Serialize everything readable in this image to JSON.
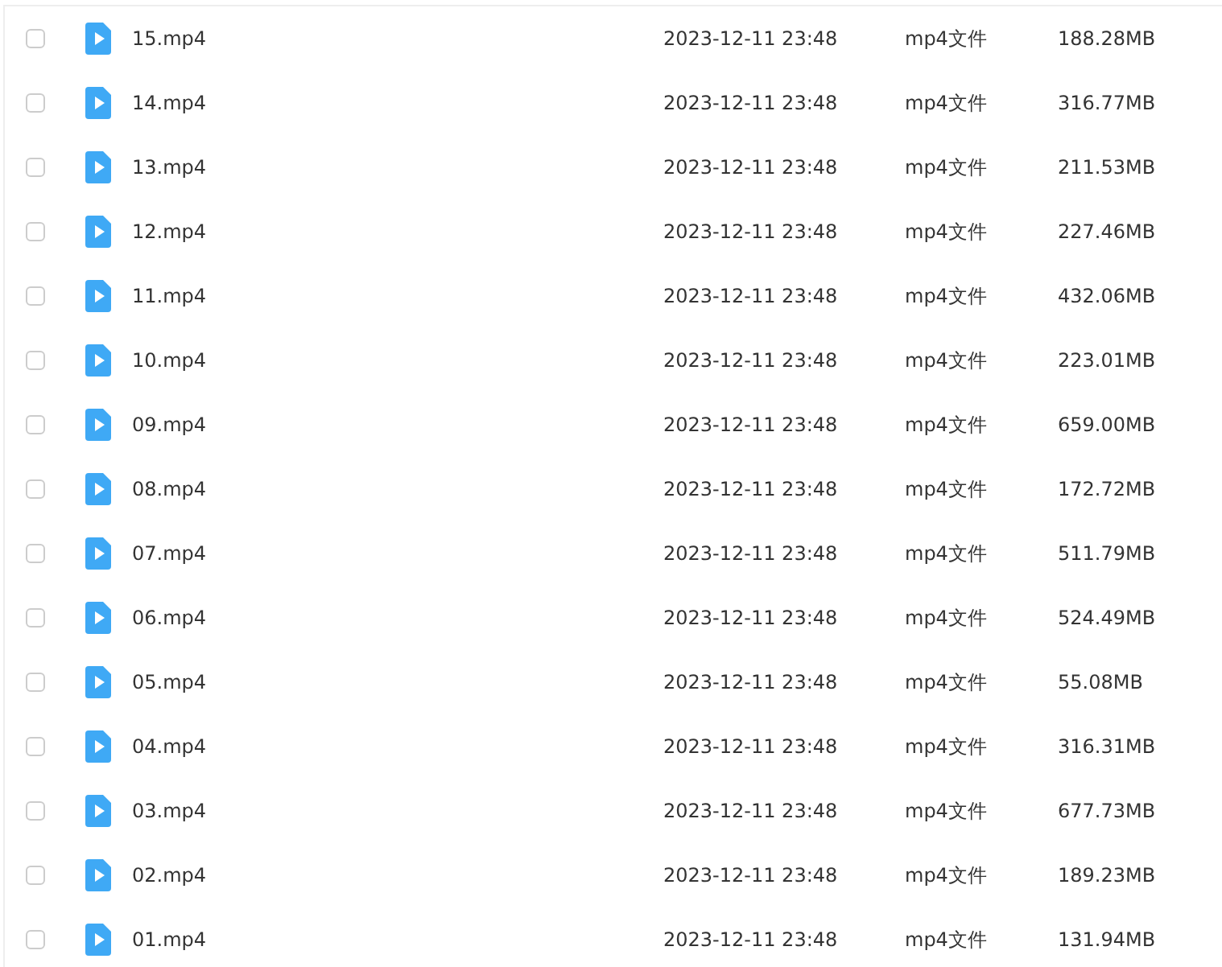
{
  "files": [
    {
      "name": "15.mp4",
      "modified": "2023-12-11 23:48",
      "type": "mp4文件",
      "size": "188.28MB",
      "checked": false
    },
    {
      "name": "14.mp4",
      "modified": "2023-12-11 23:48",
      "type": "mp4文件",
      "size": "316.77MB",
      "checked": false
    },
    {
      "name": "13.mp4",
      "modified": "2023-12-11 23:48",
      "type": "mp4文件",
      "size": "211.53MB",
      "checked": false
    },
    {
      "name": "12.mp4",
      "modified": "2023-12-11 23:48",
      "type": "mp4文件",
      "size": "227.46MB",
      "checked": false
    },
    {
      "name": "11.mp4",
      "modified": "2023-12-11 23:48",
      "type": "mp4文件",
      "size": "432.06MB",
      "checked": false
    },
    {
      "name": "10.mp4",
      "modified": "2023-12-11 23:48",
      "type": "mp4文件",
      "size": "223.01MB",
      "checked": false
    },
    {
      "name": "09.mp4",
      "modified": "2023-12-11 23:48",
      "type": "mp4文件",
      "size": "659.00MB",
      "checked": false
    },
    {
      "name": "08.mp4",
      "modified": "2023-12-11 23:48",
      "type": "mp4文件",
      "size": "172.72MB",
      "checked": false
    },
    {
      "name": "07.mp4",
      "modified": "2023-12-11 23:48",
      "type": "mp4文件",
      "size": "511.79MB",
      "checked": false
    },
    {
      "name": "06.mp4",
      "modified": "2023-12-11 23:48",
      "type": "mp4文件",
      "size": "524.49MB",
      "checked": false
    },
    {
      "name": "05.mp4",
      "modified": "2023-12-11 23:48",
      "type": "mp4文件",
      "size": "55.08MB",
      "checked": false
    },
    {
      "name": "04.mp4",
      "modified": "2023-12-11 23:48",
      "type": "mp4文件",
      "size": "316.31MB",
      "checked": false
    },
    {
      "name": "03.mp4",
      "modified": "2023-12-11 23:48",
      "type": "mp4文件",
      "size": "677.73MB",
      "checked": false
    },
    {
      "name": "02.mp4",
      "modified": "2023-12-11 23:48",
      "type": "mp4文件",
      "size": "189.23MB",
      "checked": false
    },
    {
      "name": "01.mp4",
      "modified": "2023-12-11 23:48",
      "type": "mp4文件",
      "size": "131.94MB",
      "checked": false
    }
  ]
}
